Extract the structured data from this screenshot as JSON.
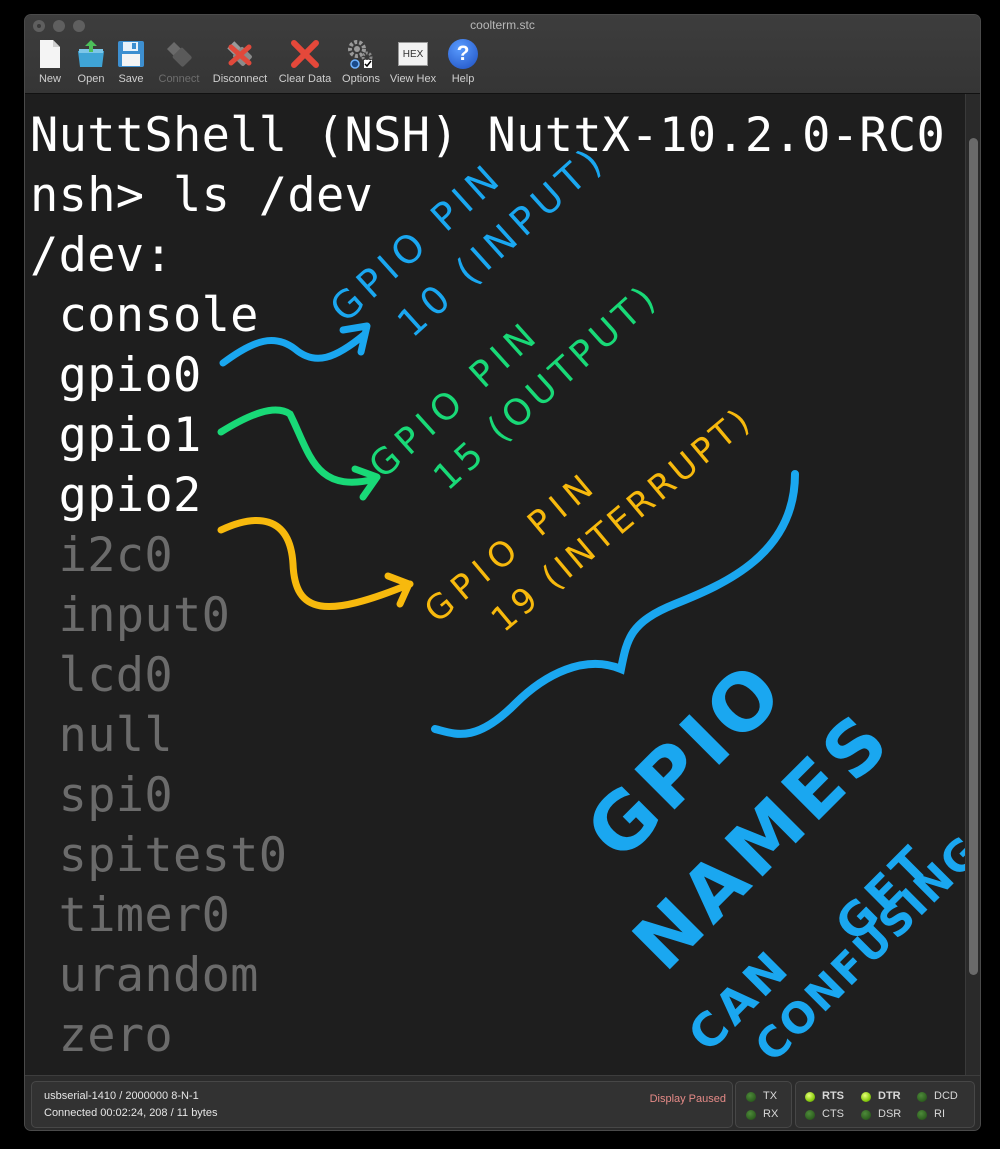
{
  "window": {
    "title": "coolterm.stc"
  },
  "toolbar": {
    "items": [
      {
        "label": "New",
        "icon": "new-document-icon",
        "enabled": true
      },
      {
        "label": "Open",
        "icon": "open-folder-icon",
        "enabled": true
      },
      {
        "label": "Save",
        "icon": "floppy-disk-icon",
        "enabled": true
      },
      {
        "label": "Connect",
        "icon": "usb-plug-icon",
        "enabled": false
      },
      {
        "label": "Disconnect",
        "icon": "disconnect-icon",
        "enabled": true
      },
      {
        "label": "Clear Data",
        "icon": "red-x-icon",
        "enabled": true
      },
      {
        "label": "Options",
        "icon": "gears-icon",
        "enabled": true
      },
      {
        "label": "View Hex",
        "icon": "hex-icon",
        "enabled": true,
        "icon_text": "HEX"
      },
      {
        "label": "Help",
        "icon": "help-icon",
        "enabled": true,
        "icon_text": "?"
      }
    ]
  },
  "terminal": {
    "lines": [
      {
        "text": "NuttShell (NSH) NuttX-10.2.0-RC0",
        "style": "bright"
      },
      {
        "text": "nsh> ls /dev",
        "style": "bright"
      },
      {
        "text": "/dev:",
        "style": "bright"
      },
      {
        "text": " console",
        "style": "bright"
      },
      {
        "text": " gpio0",
        "style": "bright"
      },
      {
        "text": " gpio1",
        "style": "bright"
      },
      {
        "text": " gpio2",
        "style": "bright"
      },
      {
        "text": " i2c0",
        "style": "dim"
      },
      {
        "text": " input0",
        "style": "dim"
      },
      {
        "text": " lcd0",
        "style": "dim"
      },
      {
        "text": " null",
        "style": "dim"
      },
      {
        "text": " spi0",
        "style": "dim"
      },
      {
        "text": " spitest0",
        "style": "dim"
      },
      {
        "text": " timer0",
        "style": "dim"
      },
      {
        "text": " urandom",
        "style": "dim"
      },
      {
        "text": " zero",
        "style": "dim"
      }
    ]
  },
  "annotations": {
    "gpio0": {
      "line1": "GPIO PIN",
      "line2": "10 (INPUT)",
      "color": "#1aa7f0"
    },
    "gpio1": {
      "line1": "GPIO PIN",
      "line2": "15 (OUTPUT)",
      "color": "#19d977"
    },
    "gpio2": {
      "line1": "GPIO PIN",
      "line2": "19 (INTERRUPT)",
      "color": "#f7b90d"
    },
    "note": {
      "words": [
        "GPIO",
        "NAMES",
        "CAN",
        "GET",
        "CONFUSING"
      ],
      "color": "#1aa7f0"
    }
  },
  "status": {
    "port_line": "usbserial-1410 / 2000000 8-N-1",
    "connection_line": "Connected 00:02:24, 208 / 11 bytes",
    "display_state": "Display Paused",
    "leds": [
      {
        "label": "TX",
        "on": false
      },
      {
        "label": "RX",
        "on": false
      },
      {
        "label": "RTS",
        "on": true
      },
      {
        "label": "CTS",
        "on": false
      },
      {
        "label": "DTR",
        "on": true
      },
      {
        "label": "DSR",
        "on": false
      },
      {
        "label": "DCD",
        "on": false
      },
      {
        "label": "RI",
        "on": false
      }
    ]
  }
}
